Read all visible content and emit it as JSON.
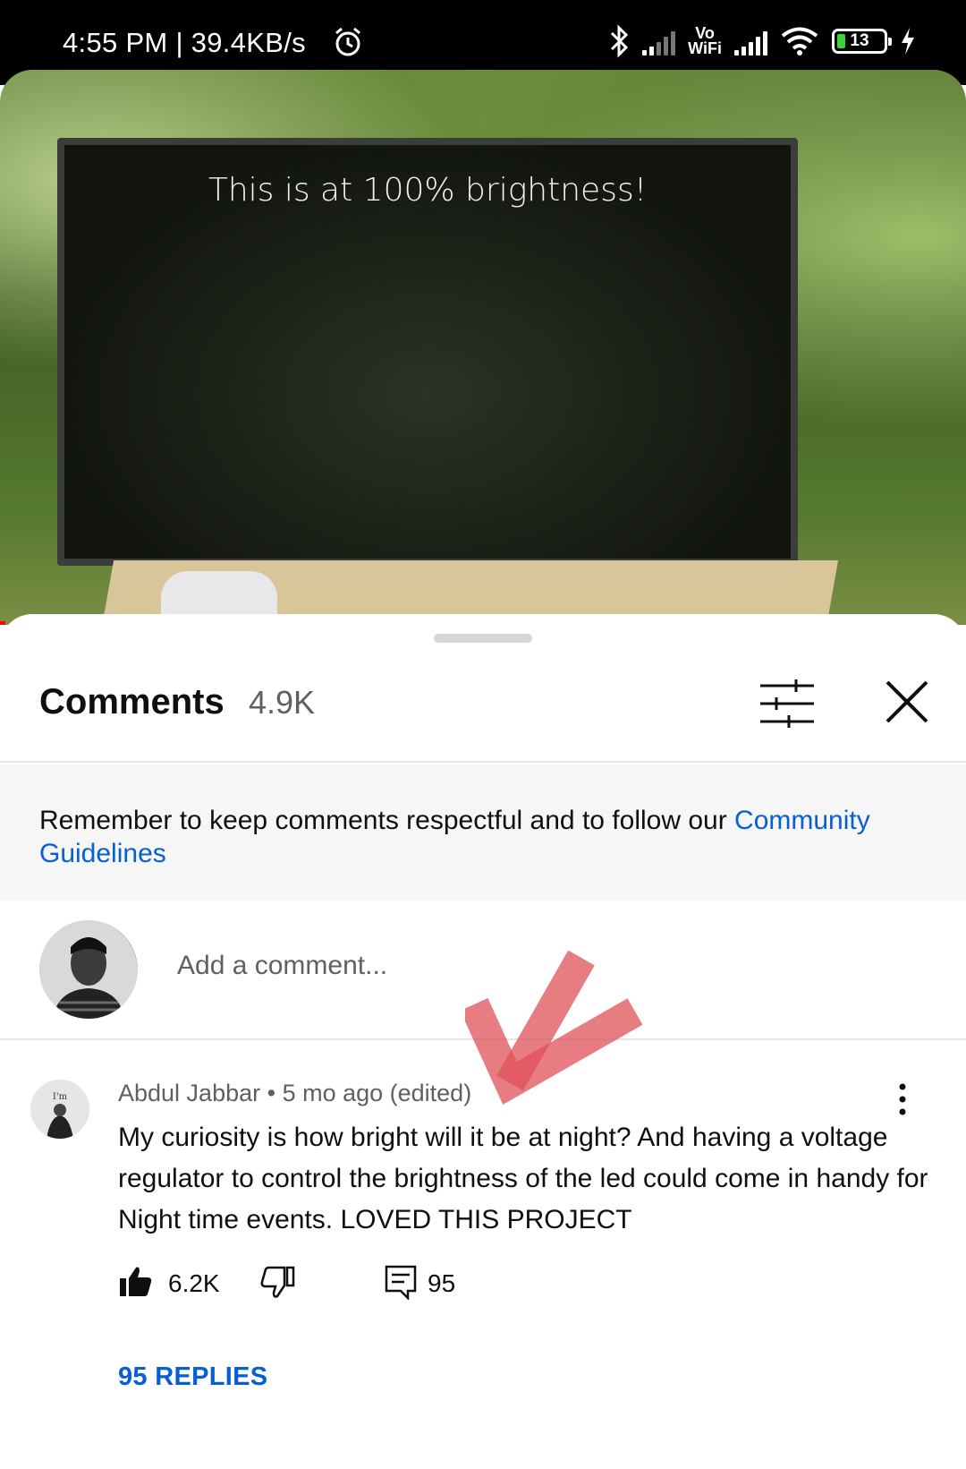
{
  "status_bar": {
    "time": "4:55 PM | 39.4KB/s",
    "vowifi_top": "Vo",
    "vowifi_bottom": "WiFi",
    "battery_level": "13",
    "icons": [
      "alarm-icon",
      "bluetooth-icon",
      "signal-icon",
      "vowifi-icon",
      "wifi-icon",
      "battery-icon",
      "charging-icon"
    ]
  },
  "video": {
    "caption": "This is at 100% brightness!"
  },
  "comments_panel": {
    "title": "Comments",
    "count": "4.9K",
    "notice_text": "Remember to keep comments respectful and to follow our ",
    "notice_link": "Community Guidelines",
    "add_comment_placeholder": "Add a comment..."
  },
  "comment": {
    "author": "Abdul Jabbar",
    "meta": "Abdul Jabbar • 5 mo ago (edited)",
    "text": "My curiosity is how bright will it be at night? And having a voltage regulator to control the brightness of the led could come in handy for Night time events. LOVED THIS PROJECT",
    "likes": "6.2K",
    "reply_count": "95",
    "replies_label": "95 REPLIES"
  },
  "colors": {
    "link": "#065fd4",
    "annotation_check": "#e0505a"
  }
}
